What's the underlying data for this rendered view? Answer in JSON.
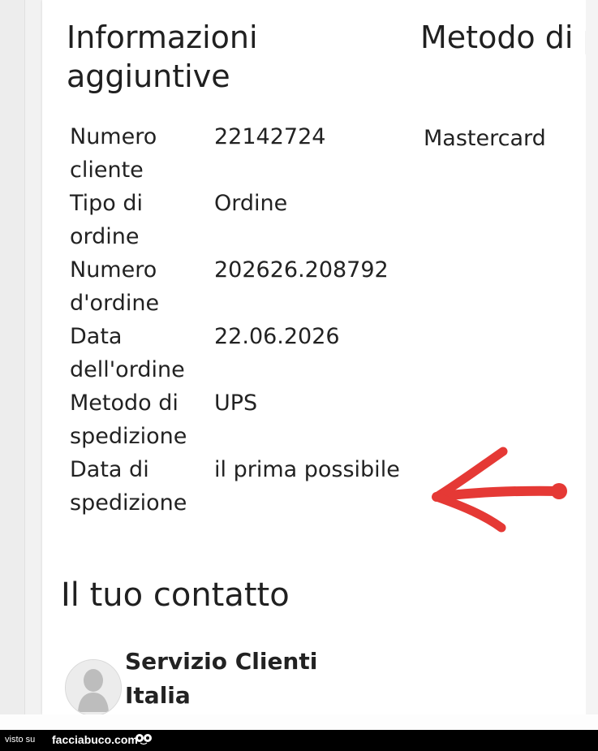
{
  "sections": {
    "info_title": "Informazioni aggiuntive",
    "payment_title": "Metodo di pagamento"
  },
  "order_info": [
    {
      "label": "Numero cliente",
      "value": "22142724"
    },
    {
      "label": "Tipo di ordine",
      "value": "Ordine"
    },
    {
      "label": "Numero d'ordine",
      "value": "202626.208792"
    },
    {
      "label": "Data dell'ordine",
      "value": "22.06.2026"
    },
    {
      "label": "Metodo di spedizione",
      "value": "UPS"
    },
    {
      "label": "Data di spedizione",
      "value": "il prima possibile"
    }
  ],
  "payment": {
    "method": "Mastercard"
  },
  "contact": {
    "title": "Il tuo contatto",
    "name": "Servizio Clienti Italia",
    "avatar_icon": "person-avatar-icon"
  },
  "watermark": {
    "visto_su": "visto su",
    "brand": "facciabuco.com",
    "icon": "face-eyes-icon"
  },
  "colors": {
    "text": "#222222",
    "annotation_arrow": "#e53935",
    "footer_bg": "#000000"
  }
}
